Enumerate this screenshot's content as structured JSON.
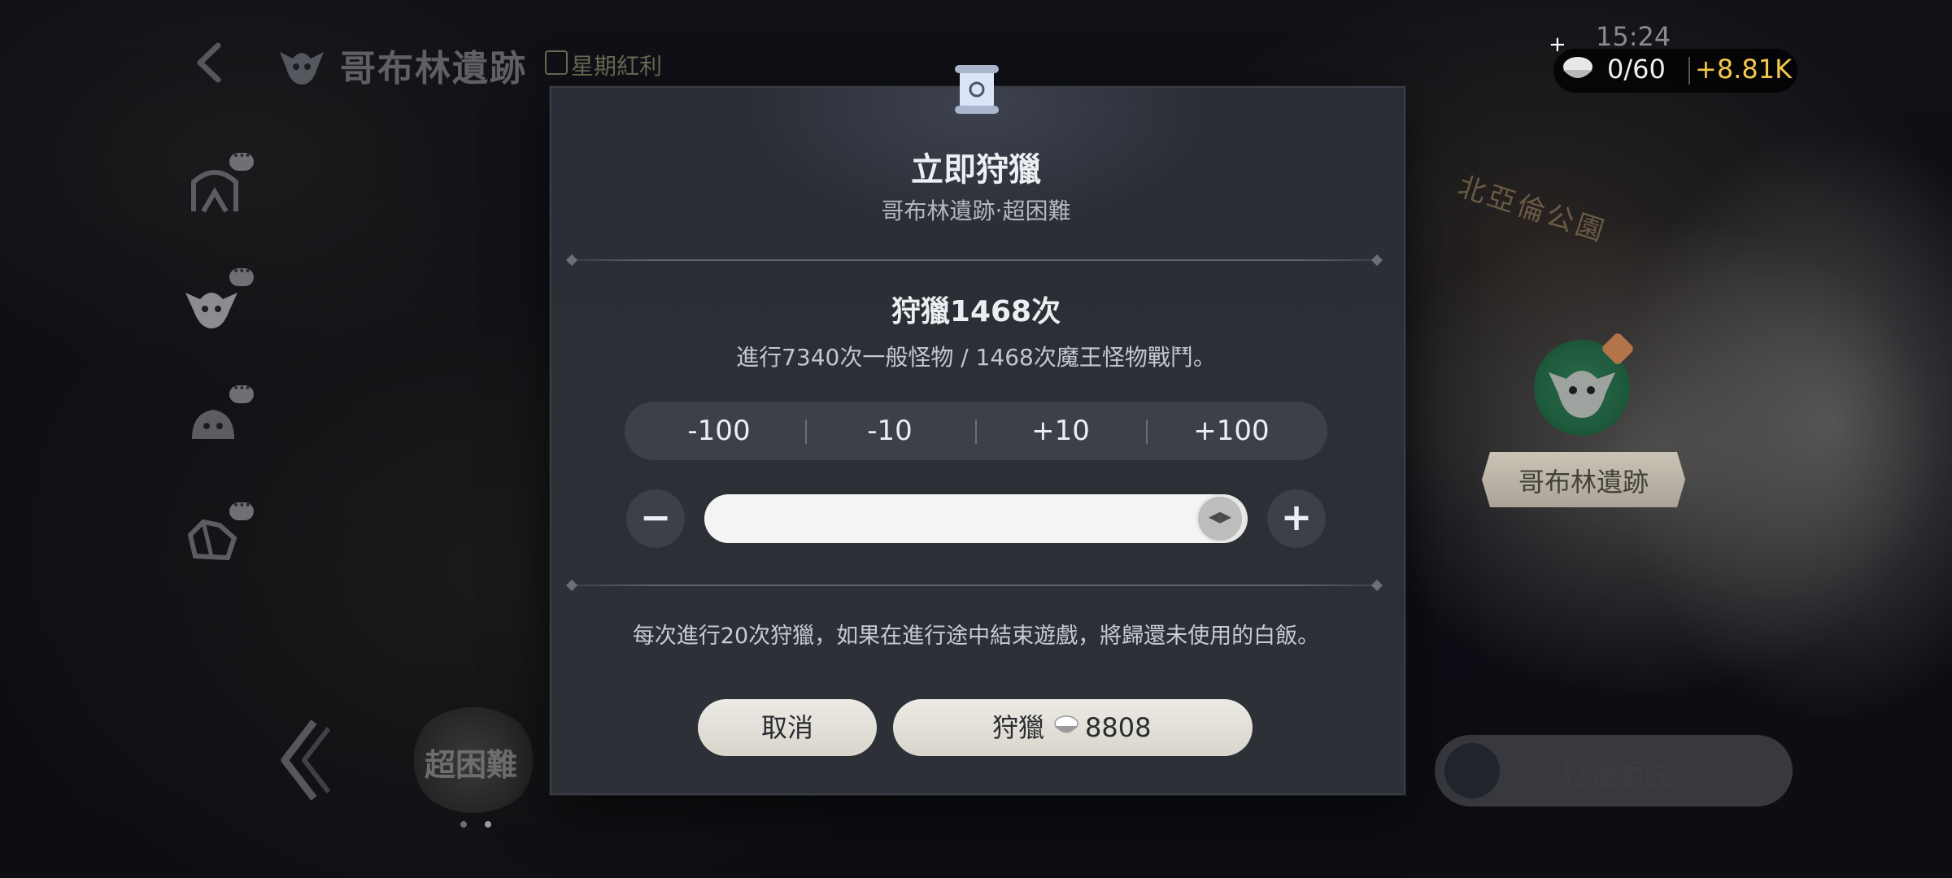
{
  "header": {
    "title": "哥布林遺跡",
    "event_label": "星期紅利"
  },
  "hud": {
    "time": "15:24",
    "plus": "+",
    "currency_count": "0/60",
    "currency_bonus": "+8.81K"
  },
  "map": {
    "region_label": "北亞倫公園",
    "location_label": "哥布林遺跡"
  },
  "bottom": {
    "difficulty": "超困難",
    "commission_label": "狩獵委託"
  },
  "modal": {
    "title": "立即狩獵",
    "subtitle": "哥布林遺跡‧超困難",
    "hunt_count": "狩獵1468次",
    "hunt_desc": "進行7340次一般怪物 / 1468次魔王怪物戰鬥。",
    "steps": [
      "-100",
      "-10",
      "+10",
      "+100"
    ],
    "decrement": "−",
    "increment": "+",
    "slider_fraction": 1.0,
    "notice": "每次進行20次狩獵，如果在進行途中結束遊戲，將歸還未使用的白飯。",
    "cancel_label": "取消",
    "hunt_label": "狩獵",
    "hunt_cost": "8808"
  },
  "colors": {
    "accent_gold": "#f2c94c",
    "button_light": "#eceae4",
    "modal_bg": "#2c2f36"
  }
}
